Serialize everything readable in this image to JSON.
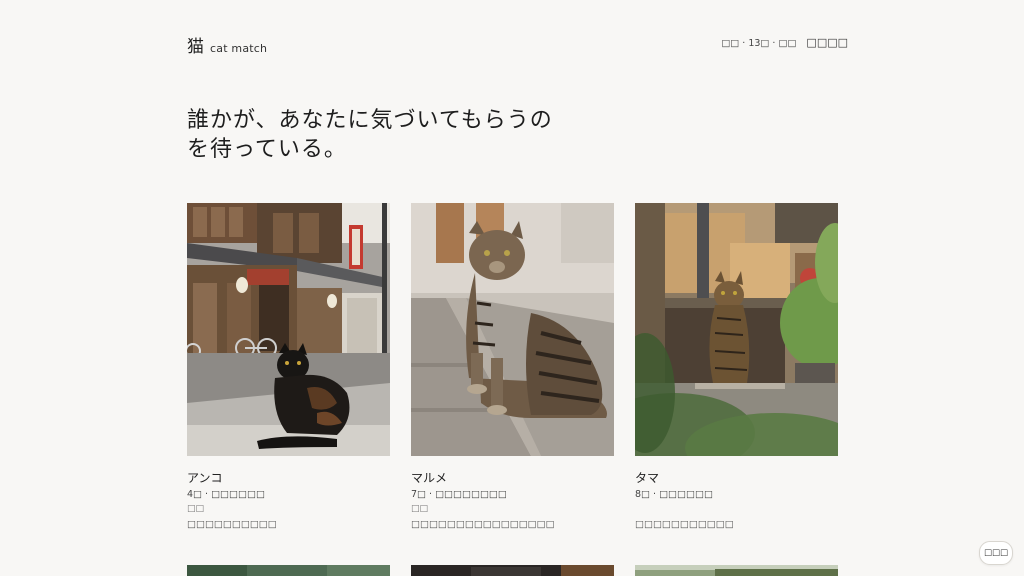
{
  "header": {
    "logo_mark": "猫",
    "logo_text": "cat match",
    "meta_text": "□□ · 13□ · □□",
    "nav_link": "□□□□"
  },
  "hero": {
    "line1": "誰かが、あなたに気づいてもらうの",
    "line2": "を待っている。"
  },
  "cats": [
    {
      "name": "アンコ",
      "sub": "4□ · □□□□□□",
      "tag": "□□",
      "desc": "□□□□□□□□□□"
    },
    {
      "name": "マルメ",
      "sub": "7□ · □□□□□□□□",
      "tag": "□□",
      "desc": "□□□□□□□□□□□□□□□□"
    },
    {
      "name": "タマ",
      "sub": "8□ · □□□□□□",
      "tag": "",
      "desc": "□□□□□□□□□□□"
    }
  ],
  "float_button": {
    "label": "□□□"
  },
  "colors": {
    "background": "#f8f7f5",
    "text": "#222222"
  },
  "icons": [
    "cat-photo-anko",
    "cat-photo-marume",
    "cat-photo-tama"
  ]
}
